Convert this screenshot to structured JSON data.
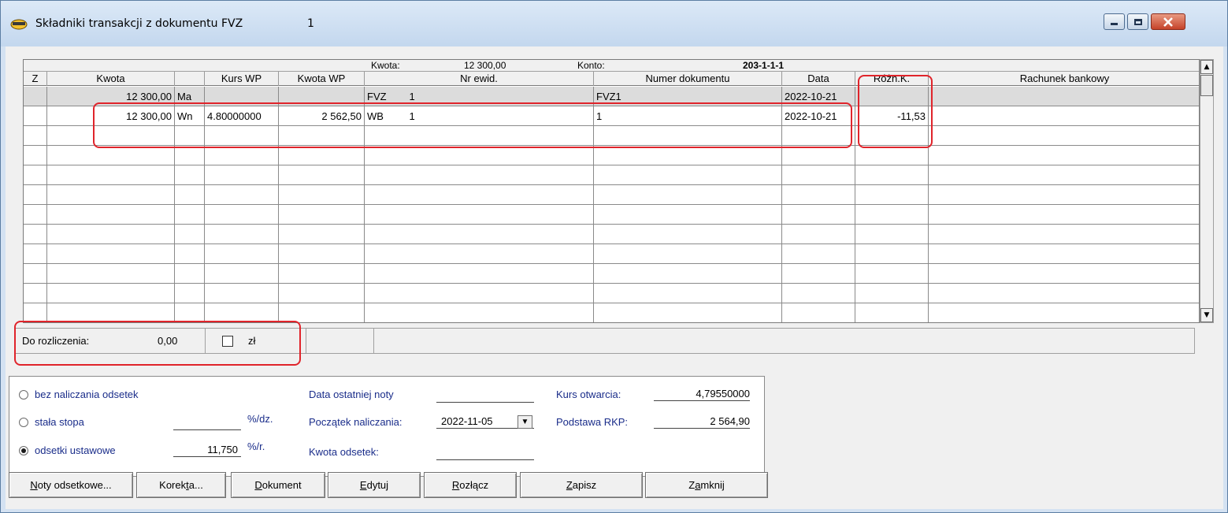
{
  "window": {
    "title": "Składniki transakcji z dokumentu FVZ",
    "title_number": "1",
    "controls": [
      "minimize-icon",
      "maximize-icon",
      "close-icon"
    ]
  },
  "grid": {
    "info": {
      "kwota_label": "Kwota:",
      "kwota_value": "12 300,00",
      "konto_label": "Konto:",
      "konto_value": "203-1-1-1"
    },
    "columns": [
      "Z",
      "Kwota",
      "",
      "Kurs WP",
      "Kwota WP",
      "Nr ewid.",
      "Numer dokumentu",
      "Data",
      "Różn.K.",
      "Rachunek bankowy"
    ],
    "rows": [
      [
        "",
        "12 300,00",
        "Ma",
        "",
        "",
        "FVZ        1",
        "FVZ1",
        "2022-10-21",
        "",
        ""
      ],
      [
        "",
        "12 300,00",
        "Wn",
        "4.80000000",
        "2 562,50",
        "WB         1",
        "1",
        "2022-10-21",
        "-11,53",
        ""
      ]
    ]
  },
  "status": {
    "do_rozliczenia_label": "Do rozliczenia:",
    "do_rozliczenia_value": "0,00",
    "currency": "zł"
  },
  "options": {
    "bez_naliczania": "bez naliczania odsetek",
    "stala_stopa": "stała stopa",
    "stala_stopa_unit": "%/dz.",
    "stala_stopa_value": "",
    "odsetki_ustawowe": "odsetki ustawowe",
    "odsetki_value": "11,750",
    "odsetki_unit": "%/r.",
    "selected": "odsetki_ustawowe",
    "data_ostatniej_noty_label": "Data ostatniej noty",
    "data_ostatniej_noty_value": "",
    "poczatek_naliczania_label": "Początek naliczania:",
    "poczatek_naliczania_value": "2022-11-05",
    "kwota_odsetek_label": "Kwota odsetek:",
    "kwota_odsetek_value": "",
    "kurs_otwarcia_label": "Kurs otwarcia:",
    "kurs_otwarcia_value": "4,79550000",
    "podstawa_rkp_label": "Podstawa RKP:",
    "podstawa_rkp_value": "2 564,90"
  },
  "buttons": {
    "noty": {
      "pre": "",
      "key": "N",
      "post": "oty odsetkowe..."
    },
    "korekta": {
      "pre": "Korek",
      "key": "t",
      "post": "a..."
    },
    "dokument": {
      "pre": "",
      "key": "D",
      "post": "okument"
    },
    "edytuj": {
      "pre": "",
      "key": "E",
      "post": "dytuj"
    },
    "rozlacz": {
      "pre": "",
      "key": "R",
      "post": "ozłącz"
    },
    "zapisz": {
      "pre": "",
      "key": "Z",
      "post": "apisz"
    },
    "zamknij": {
      "pre": "Z",
      "key": "a",
      "post": "mknij"
    }
  },
  "colors": {
    "highlight": "#e0242b",
    "option_text": "#1a2d8a",
    "selected_row": "#dcdcdc"
  }
}
